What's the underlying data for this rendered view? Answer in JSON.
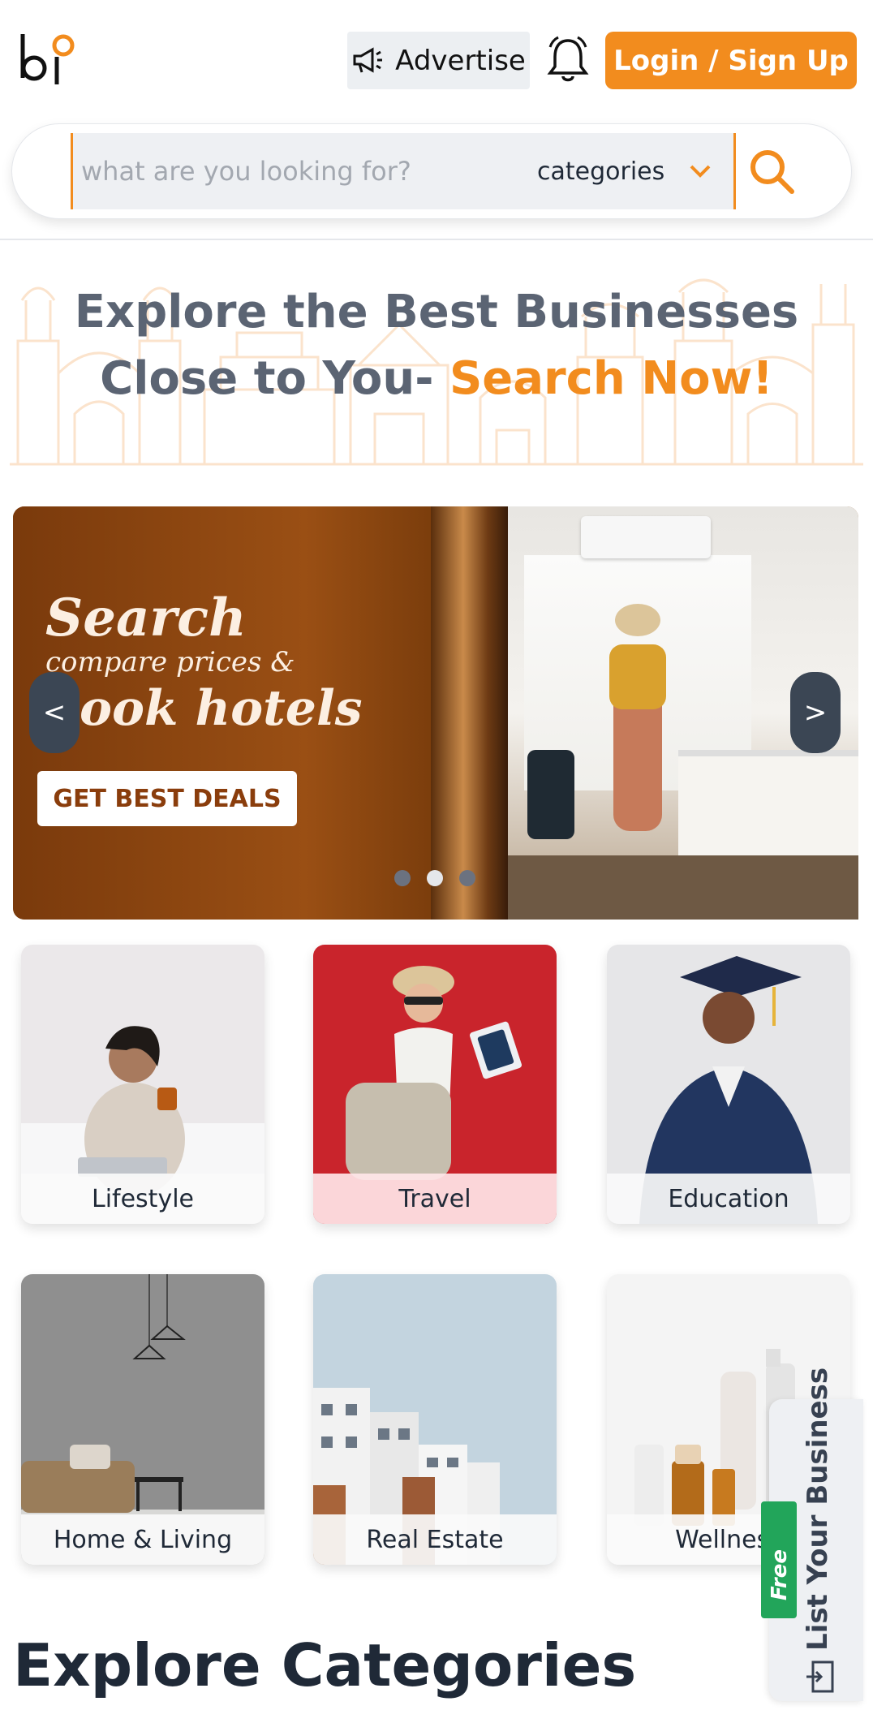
{
  "header": {
    "logo_alt": "bi",
    "advertise_label": "Advertise",
    "login_label": "Login / Sign Up"
  },
  "search": {
    "placeholder": "what are you looking for?",
    "category_select": "categories"
  },
  "hero": {
    "title_part1": "Explore the Best Businesses Close to You- ",
    "title_accent": "Search Now!"
  },
  "carousel": {
    "line1": "Search",
    "line2": "compare prices &",
    "line3": "book hotels",
    "cta": "GET BEST DEALS",
    "prev": "<",
    "next": ">",
    "active_slide": 2,
    "slide_count": 3
  },
  "categories": [
    {
      "label": "Lifestyle"
    },
    {
      "label": "Travel"
    },
    {
      "label": "Education"
    },
    {
      "label": "Home & Living"
    },
    {
      "label": "Real Estate"
    },
    {
      "label": "Wellness"
    }
  ],
  "list_business": {
    "label": "List Your Business",
    "badge": "Free"
  },
  "section": {
    "explore_title": "Explore Categories"
  },
  "colors": {
    "accent": "#f28c1e",
    "badge_green": "#22a55a"
  }
}
